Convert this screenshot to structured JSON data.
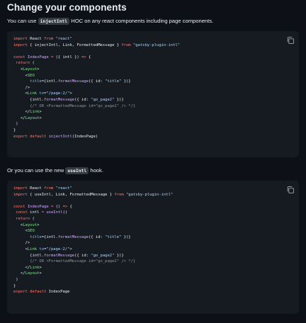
{
  "heading": "Change your components",
  "para1": {
    "before": "You can use ",
    "code": "injectIntl",
    "after": " HOC on any react components including page components."
  },
  "para2": {
    "before": "Or you can use the new ",
    "code": "useIntl",
    "after": " hook."
  },
  "code_block_1": [
    [
      [
        "kw",
        "import"
      ],
      [
        "",
        "  React "
      ],
      [
        "kw",
        "from"
      ],
      [
        "",
        ""
      ],
      [
        "str",
        " \"react\""
      ]
    ],
    [
      [
        "kw",
        "import"
      ],
      [
        "",
        "  { injectIntl, Link, FormattedMessage } "
      ],
      [
        "kw",
        "from"
      ],
      [
        "str",
        " \"gatsby-plugin-intl\""
      ]
    ],
    [],
    [
      [
        "kw",
        "const"
      ],
      [
        "fn",
        " IndexPage"
      ],
      [
        "",
        ""
      ],
      [
        "kw",
        " ="
      ],
      [
        "",
        ""
      ],
      [
        "",
        "  ({ intl }) "
      ],
      [
        "kw",
        "=>"
      ],
      [
        "",
        ""
      ],
      [
        "",
        ""
      ],
      [
        "",
        "  {"
      ]
    ],
    [
      [
        "",
        "  "
      ],
      [
        "kw",
        "return"
      ],
      [
        "",
        ""
      ],
      [
        "",
        ""
      ],
      [
        "",
        "  ("
      ]
    ],
    [
      [
        "",
        "    <"
      ],
      [
        "tag",
        "Layout"
      ],
      [
        "",
        ">"
      ]
    ],
    [
      [
        "",
        "      <"
      ],
      [
        "tag",
        "SEO"
      ]
    ],
    [
      [
        "",
        "        "
      ],
      [
        "attr",
        "title"
      ],
      [
        "",
        "={intl."
      ],
      [
        "fn",
        "formatMessage"
      ],
      [
        "",
        "({ id: "
      ],
      [
        "str",
        "\"title\""
      ],
      [
        "",
        ""
      ],
      [
        "",
        "  })}"
      ]
    ],
    [
      [
        "",
        "      />"
      ]
    ],
    [
      [
        "",
        "      <"
      ],
      [
        "tag",
        "Link"
      ],
      [
        "attr",
        " to"
      ],
      [
        "",
        "="
      ],
      [
        "str",
        "\"/page-2/\""
      ],
      [
        "",
        ">"
      ]
    ],
    [
      [
        "",
        "        {intl."
      ],
      [
        "fn",
        "formatMessage"
      ],
      [
        "",
        "({ id: "
      ],
      [
        "str",
        "\"go_page2\""
      ],
      [
        "",
        ""
      ],
      [
        "",
        "  })}"
      ]
    ],
    [
      [
        "",
        "        "
      ],
      [
        "com",
        "{/* OR <FormattedMessage id=\"go_page2\" /> */}"
      ]
    ],
    [
      [
        "",
        "      </"
      ],
      [
        "tag",
        "Link"
      ],
      [
        "",
        ">"
      ]
    ],
    [
      [
        "",
        "    </"
      ],
      [
        "tag",
        "Layout"
      ],
      [
        "",
        ">"
      ]
    ],
    [
      [
        "",
        "  )"
      ]
    ],
    [
      [
        "",
        "}"
      ]
    ],
    [
      [
        "kw",
        "export"
      ],
      [
        "kw",
        " default"
      ],
      [
        "",
        "  "
      ],
      [
        "fn",
        "injectIntl"
      ],
      [
        "",
        "(IndexPage)"
      ]
    ]
  ],
  "code_block_2": [
    [
      [
        "kw",
        "import"
      ],
      [
        "",
        "  React "
      ],
      [
        "kw",
        "from"
      ],
      [
        "str",
        " \"react\""
      ]
    ],
    [
      [
        "kw",
        "import"
      ],
      [
        "",
        "  { useIntl, Link, FormattedMessage } "
      ],
      [
        "kw",
        "from"
      ],
      [
        "str",
        " \"gatsby-plugin-intl\""
      ]
    ],
    [],
    [
      [
        "kw",
        "const"
      ],
      [
        "fn",
        " IndexPage"
      ],
      [
        "kw",
        " ="
      ],
      [
        "",
        "  () "
      ],
      [
        "kw",
        "=>"
      ],
      [
        "",
        "  {"
      ]
    ],
    [
      [
        "",
        "  "
      ],
      [
        "kw",
        "const"
      ],
      [
        "",
        "  intl "
      ],
      [
        "kw",
        "="
      ],
      [
        "fn",
        " useIntl"
      ],
      [
        "",
        "()"
      ]
    ],
    [
      [
        "",
        "  "
      ],
      [
        "kw",
        "return"
      ],
      [
        "",
        "  ("
      ]
    ],
    [
      [
        "",
        "    <"
      ],
      [
        "tag",
        "Layout"
      ],
      [
        "",
        ">"
      ]
    ],
    [
      [
        "",
        "      <"
      ],
      [
        "tag",
        "SEO"
      ]
    ],
    [
      [
        "",
        "        "
      ],
      [
        "attr",
        "title"
      ],
      [
        "",
        "={intl."
      ],
      [
        "fn",
        "formatMessage"
      ],
      [
        "",
        "({ id: "
      ],
      [
        "str",
        "\"title\""
      ],
      [
        "",
        "  })}"
      ]
    ],
    [
      [
        "",
        "      />"
      ]
    ],
    [
      [
        "",
        "      <"
      ],
      [
        "tag",
        "Link"
      ],
      [
        "attr",
        " to"
      ],
      [
        "",
        "="
      ],
      [
        "str",
        "\"/page-2/\""
      ],
      [
        "",
        ">"
      ]
    ],
    [
      [
        "",
        "        {intl."
      ],
      [
        "fn",
        "formatMessage"
      ],
      [
        "",
        "({ id: "
      ],
      [
        "str",
        "\"go_page2\""
      ],
      [
        "",
        "  })}"
      ]
    ],
    [
      [
        "",
        "        "
      ],
      [
        "com",
        "{/* OR <FormattedMessage id=\"go_page2\" /> */}"
      ]
    ],
    [
      [
        "",
        "      </"
      ],
      [
        "tag",
        "Link"
      ],
      [
        "",
        ">"
      ]
    ],
    [
      [
        "",
        "    </"
      ],
      [
        "tag",
        "Layout"
      ],
      [
        "",
        ">"
      ]
    ],
    [
      [
        "",
        "  )"
      ]
    ],
    [
      [
        "",
        "}"
      ]
    ],
    [
      [
        "kw",
        "export"
      ],
      [
        "kw",
        " default"
      ],
      [
        "",
        "  IndexPage"
      ]
    ]
  ],
  "icons": {
    "copy": "copy-icon"
  },
  "colors": {
    "background": "#0d1117",
    "code_bg": "#161b22",
    "keyword": "#ff7b72",
    "string": "#a5d6ff",
    "function": "#d2a8ff",
    "tag": "#7ee787",
    "comment": "#8b949e"
  }
}
